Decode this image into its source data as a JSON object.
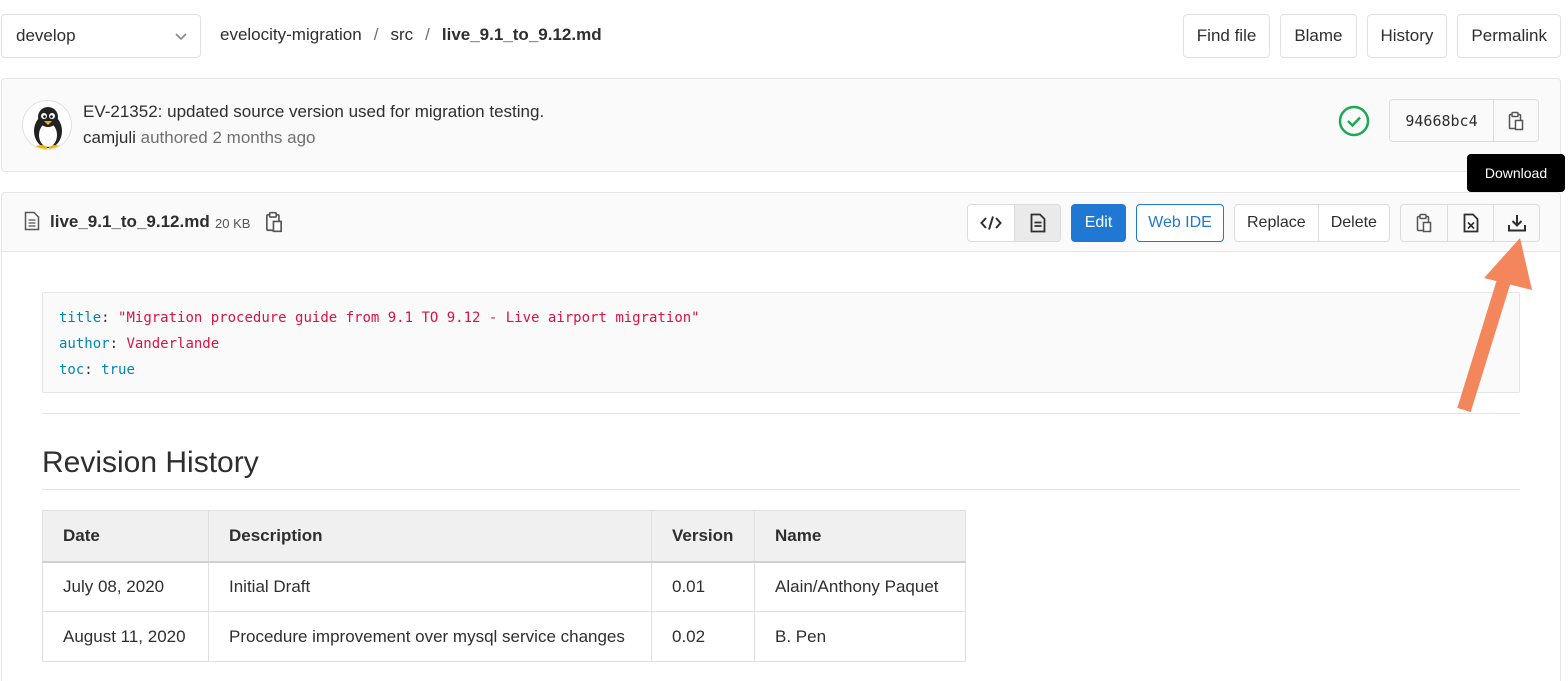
{
  "branch": {
    "name": "develop",
    "icon": "chevron-down-icon"
  },
  "breadcrumb": {
    "project": "evelocity-migration",
    "sep": "/",
    "folder": "src",
    "file": "live_9.1_to_9.12.md"
  },
  "top_actions": {
    "find_file": "Find file",
    "blame": "Blame",
    "history": "History",
    "permalink": "Permalink"
  },
  "commit": {
    "title": "EV-21352: updated source version used for migration testing.",
    "author": "camjuli",
    "authored": "authored",
    "time": "2 months ago",
    "sha": "94668bc4",
    "status_color": "#1aaa55"
  },
  "tooltip": {
    "text": "Download"
  },
  "file": {
    "name": "live_9.1_to_9.12.md",
    "size": "20 KB"
  },
  "file_actions": {
    "edit": "Edit",
    "web_ide": "Web IDE",
    "replace": "Replace",
    "delete": "Delete"
  },
  "front_matter": {
    "title_key": "title",
    "title_value": "\"Migration procedure guide from 9.1 TO 9.12 - Live airport migration\"",
    "author_key": "author",
    "author_value": "Vanderlande",
    "toc_key": "toc",
    "toc_value": "true",
    "colon": ":"
  },
  "content": {
    "heading": "Revision History",
    "table": {
      "headers": [
        "Date",
        "Description",
        "Version",
        "Name"
      ],
      "rows": [
        [
          "July 08, 2020",
          "Initial Draft",
          "0.01",
          "Alain/Anthony Paquet"
        ],
        [
          "August 11, 2020",
          "Procedure improvement over mysql service changes",
          "0.02",
          "B. Pen"
        ]
      ]
    }
  },
  "colors": {
    "primary": "#1f78d1",
    "annotation_arrow": "#f4865c"
  }
}
